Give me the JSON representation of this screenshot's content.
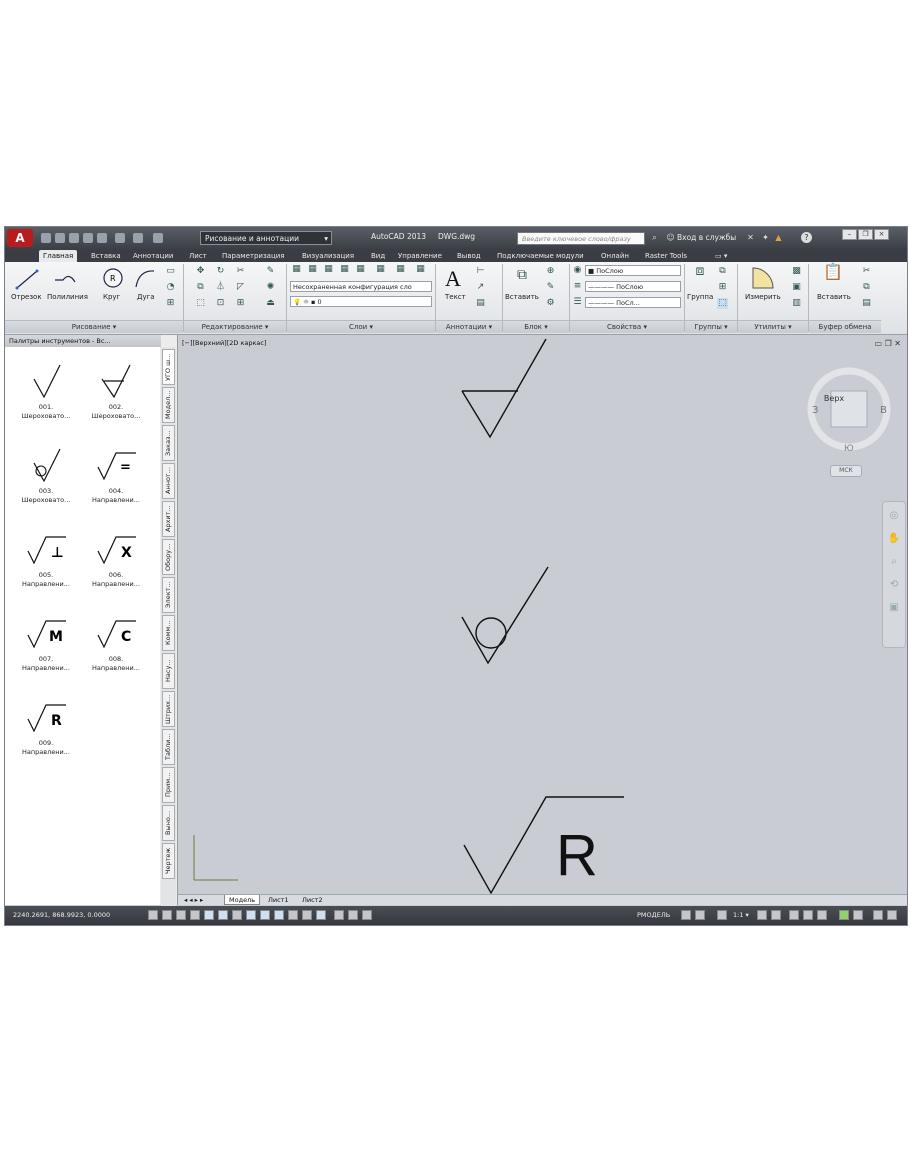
{
  "app": {
    "title": "AutoCAD 2013",
    "file": "DWG.dwg",
    "logo": "A"
  },
  "workspace": {
    "value": "Рисование и аннотации"
  },
  "search": {
    "placeholder": "Введите ключевое слово/фразу"
  },
  "signin": "Вход в службы",
  "tabs": [
    "Главная",
    "Вставка",
    "Аннотации",
    "Лист",
    "Параметризация",
    "Визуализация",
    "Вид",
    "Управление",
    "Вывод",
    "Подключаемые модули",
    "Онлайн",
    "Raster Tools"
  ],
  "ribbon": {
    "draw": {
      "line": "Отрезок",
      "polyline": "Полилиния",
      "circle": "Круг",
      "arc": "Дуга",
      "title": "Рисование"
    },
    "modify": {
      "title": "Редактирование"
    },
    "layers": {
      "combo": "Несохраненная конфигурация сло",
      "layer": "0",
      "title": "Слои"
    },
    "annotation": {
      "text": "Текст",
      "title": "Аннотации"
    },
    "block": {
      "insert": "Вставить",
      "title": "Блок"
    },
    "properties": {
      "color": "ПоСлою",
      "linetype": "ПоСлою",
      "lineweight": "ПоСл...",
      "title": "Свойства"
    },
    "groups": {
      "group": "Группа",
      "title": "Группы"
    },
    "utilities": {
      "measure": "Измерить",
      "title": "Утилиты"
    },
    "clipboard": {
      "paste": "Вставить",
      "title": "Буфер обмена"
    }
  },
  "palette": {
    "title": "Палитры инструментов - Вс...",
    "tools": [
      {
        "num": "001.",
        "label": "Шероховато..."
      },
      {
        "num": "002.",
        "label": "Шероховато..."
      },
      {
        "num": "003.",
        "label": "Шероховато..."
      },
      {
        "num": "004.",
        "label": "Направлени..."
      },
      {
        "num": "005.",
        "label": "Направлени..."
      },
      {
        "num": "006.",
        "label": "Направлени..."
      },
      {
        "num": "007.",
        "label": "Направлени..."
      },
      {
        "num": "008.",
        "label": "Направлени..."
      },
      {
        "num": "009.",
        "label": "Направлени..."
      }
    ],
    "symbols": [
      "",
      "",
      "",
      "=",
      "⊥",
      "X",
      "M",
      "C",
      "R"
    ],
    "side_tabs": [
      "УГО ш...",
      "Модел...",
      "Заказ...",
      "Аннот...",
      "Архит...",
      "Обору...",
      "Элект...",
      "Комм...",
      "Насу...",
      "Штрих...",
      "Табли...",
      "Прим...",
      "Выно...",
      "Чертеж"
    ]
  },
  "viewport": {
    "label": "[−][Верхний][2D каркас]",
    "viewcube_face": "Верх",
    "ucs": "МСК",
    "drawing_letter": "R"
  },
  "layout_tabs": [
    "Модель",
    "Лист1",
    "Лист2"
  ],
  "status": {
    "coords": "2240.2691, 868.9923, 0.0000",
    "space": "РМОДЕЛЬ",
    "scale": "1:1"
  },
  "colors": {
    "accent": "#b81c1c",
    "titlebar": "#3b3f46",
    "canvas": "#c9cdd3"
  }
}
